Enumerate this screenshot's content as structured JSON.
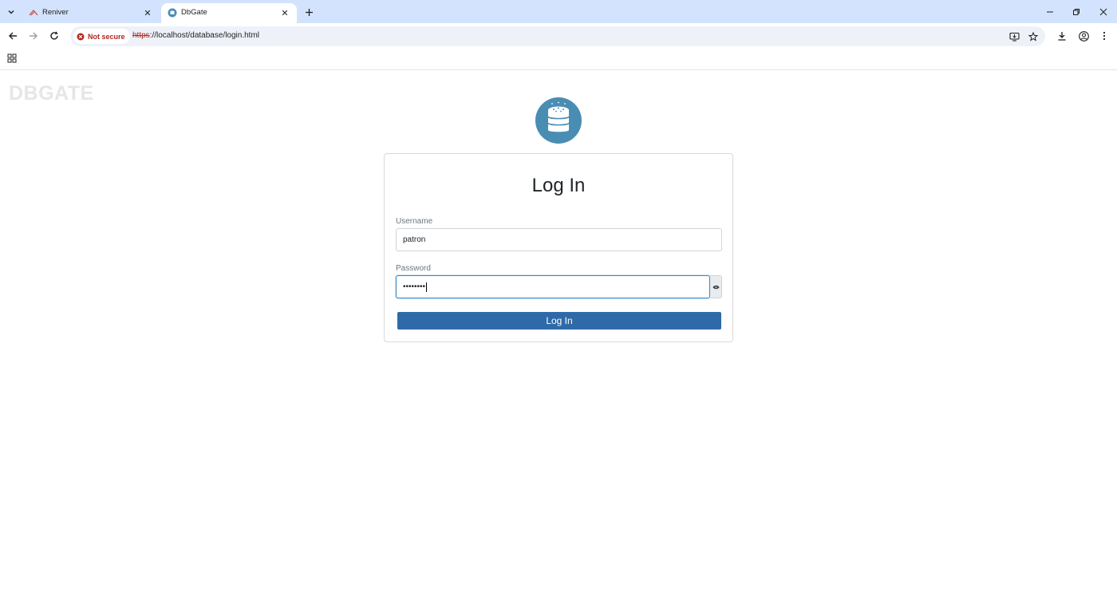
{
  "browser": {
    "tabs": [
      {
        "title": "Reniver",
        "active": false,
        "favicon": "reniver-icon"
      },
      {
        "title": "DbGate",
        "active": true,
        "favicon": "dbgate-icon"
      }
    ],
    "security_chip": "Not secure",
    "url_scheme": "https",
    "url_rest": "://localhost/database/login.html",
    "colors": {
      "tabstrip": "#d3e3fd",
      "not_secure": "#b3261e"
    }
  },
  "page": {
    "brand_mark": "DBGATE",
    "login": {
      "title": "Log In",
      "username_label": "Username",
      "username_value": "patron",
      "password_label": "Password",
      "password_value": "••••••••",
      "submit_label": "Log In"
    },
    "colors": {
      "accent": "#2f6aa8",
      "logo": "#4a8db3"
    }
  }
}
